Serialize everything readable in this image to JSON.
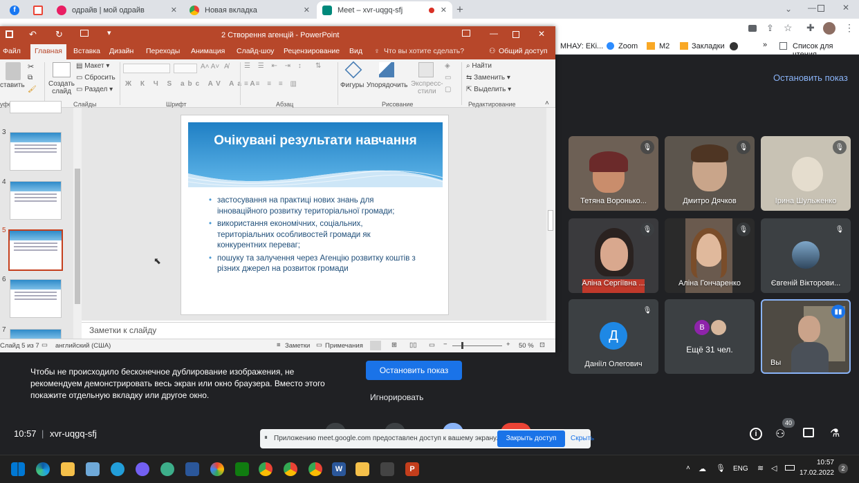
{
  "browser": {
    "tabs": [
      {
        "title": "",
        "icon": "facebook-icon"
      },
      {
        "title": "",
        "icon": "gmail-icon"
      },
      {
        "title": "одрайв | мой одрайв",
        "icon": "odrive-icon"
      },
      {
        "title": "Новая вкладка",
        "icon": "chrome-icon"
      },
      {
        "title": "Meet – xvr-uqgq-sfj",
        "icon": "meet-icon"
      }
    ],
    "new_tab": "+",
    "bookmarks": [
      "МНАУ: ЕКі...",
      "Zoom",
      "M2",
      "Закладки",
      "Список для чтения"
    ],
    "bookmarks_more": "»"
  },
  "ppt": {
    "title": "2 Створення агенцій - PowerPoint",
    "menu": [
      "Файл",
      "Главная",
      "Вставка",
      "Дизайн",
      "Переходы",
      "Анимация",
      "Слайд-шоу",
      "Рецензирование",
      "Вид"
    ],
    "tell_me": "Что вы хотите сделать?",
    "share": "Общий доступ",
    "ribbon": {
      "paste": "ставить",
      "create_slide": "Создать\nслайд",
      "layout": "Макет",
      "reset": "Сбросить",
      "section": "Раздел",
      "shapes": "Фигуры",
      "arrange": "Упорядочить",
      "quick_styles": "Экспресс-\nстили",
      "find": "Найти",
      "replace": "Заменить",
      "select": "Выделить",
      "groups": [
        "уфер обмена",
        "Слайды",
        "Шрифт",
        "Абзац",
        "Рисование",
        "Редактирование"
      ]
    },
    "thumb_numbers": [
      "3",
      "4",
      "5",
      "6",
      "7"
    ],
    "slide": {
      "title": "Очікувані результати навчання",
      "bullets": [
        "застосування на практиці нових знань для інноваційного розвитку територіальної громади;",
        "використання економічних, соціальних, територіальних особливостей громади як конкурентних переваг;",
        "пошуку та залучення через Агенцію розвитку коштів з різних джерел на розвиток громади"
      ]
    },
    "notes_placeholder": "Заметки к слайду",
    "status": {
      "slide_of": "Слайд 5 из 7",
      "language": "английский (США)",
      "notes": "Заметки",
      "comments": "Примечания",
      "zoom": "50 %"
    }
  },
  "meet": {
    "stop_presenting_top": "Остановить показ",
    "participants": [
      {
        "name": "Тетяна Воронько...",
        "muted": true
      },
      {
        "name": "Дмитро Дячков",
        "muted": true
      },
      {
        "name": "Ірина Шульженко",
        "muted": true
      },
      {
        "name": "Аліна Сергіївна ...",
        "muted": true
      },
      {
        "name": "Аліна Гончаренко",
        "muted": true
      },
      {
        "name": "Євгеній Вікторови...",
        "muted": true
      },
      {
        "name": "Даніїл Олегович",
        "muted": true,
        "initial": "Д"
      },
      {
        "name": "Ещё 31 чел.",
        "initial": "В"
      },
      {
        "name": "Вы",
        "speaking": true
      }
    ],
    "warning": "Чтобы не происходило бесконечное дублирование изображения, не рекомендуем демонстрировать весь экран или окно браузера. Вместо этого покажите отдельную вкладку или другое окно.",
    "stop_presenting": "Остановить показ",
    "ignore": "Игнорировать",
    "time": "10:57",
    "code": "xvr-uqgq-sfj",
    "participant_count": "40",
    "share_notice": "Приложению meet.google.com предоставлен доступ к вашему экрану.",
    "close_access": "Закрыть доступ",
    "hide": "Скрыть"
  },
  "taskbar": {
    "lang": "ENG",
    "time": "10:57",
    "date": "17.02.2022",
    "notif": "2"
  }
}
